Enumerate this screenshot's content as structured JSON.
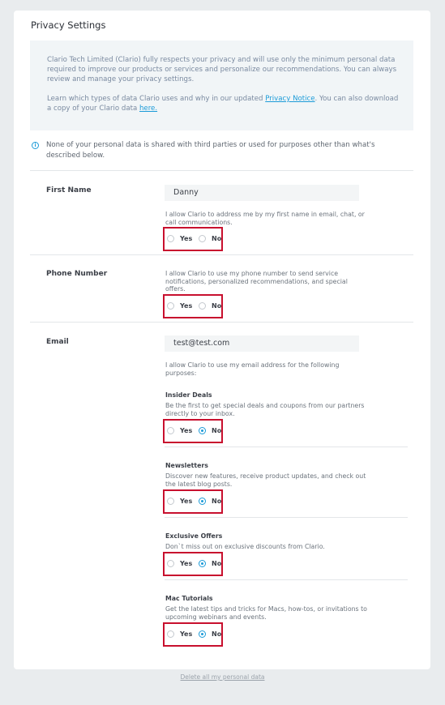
{
  "title": "Privacy Settings",
  "notice": {
    "p1": "Clario Tech Limited (Clario) fully respects your privacy and will use only the minimum personal data required to improve our products or services and personalize our recommendations. You can always review and manage your privacy settings.",
    "p2_before": "Learn which types of data Clario uses and why in our updated ",
    "privacy_link": "Privacy Notice",
    "p2_middle": ". You can also download a copy of your Clario data ",
    "here_link": "here."
  },
  "info_text": "None of your personal data is shared with third parties or used for purposes other than what's described below.",
  "options": {
    "yes": "Yes",
    "no": "No"
  },
  "first_name": {
    "label": "First Name",
    "value": "Danny",
    "desc": "I allow Clario to address me by my first name in email, chat, or call communications."
  },
  "phone": {
    "label": "Phone Number",
    "desc": "I allow Clario to use my phone number to send service notifications, personalized recommendations, and special offers."
  },
  "email": {
    "label": "Email",
    "value": "test@test.com",
    "desc": "I allow Clario to use my email address for the following purposes:"
  },
  "insider": {
    "title": "Insider Deals",
    "desc": "Be the first to get special deals and coupons from our partners directly to your inbox."
  },
  "newsletters": {
    "title": "Newsletters",
    "desc": "Discover new features, receive product updates, and check out the latest blog posts."
  },
  "exclusive": {
    "title": "Exclusive Offers",
    "desc": "Don`t miss out on exclusive discounts from Clario."
  },
  "mac": {
    "title": "Mac Tutorials",
    "desc": "Get the latest tips and tricks for Macs, how-tos, or invitations to upcoming webinars and events."
  },
  "delete_link": "Delete all my personal data",
  "colors": {
    "accent": "#1c9bd8",
    "highlight": "#c8102e"
  }
}
